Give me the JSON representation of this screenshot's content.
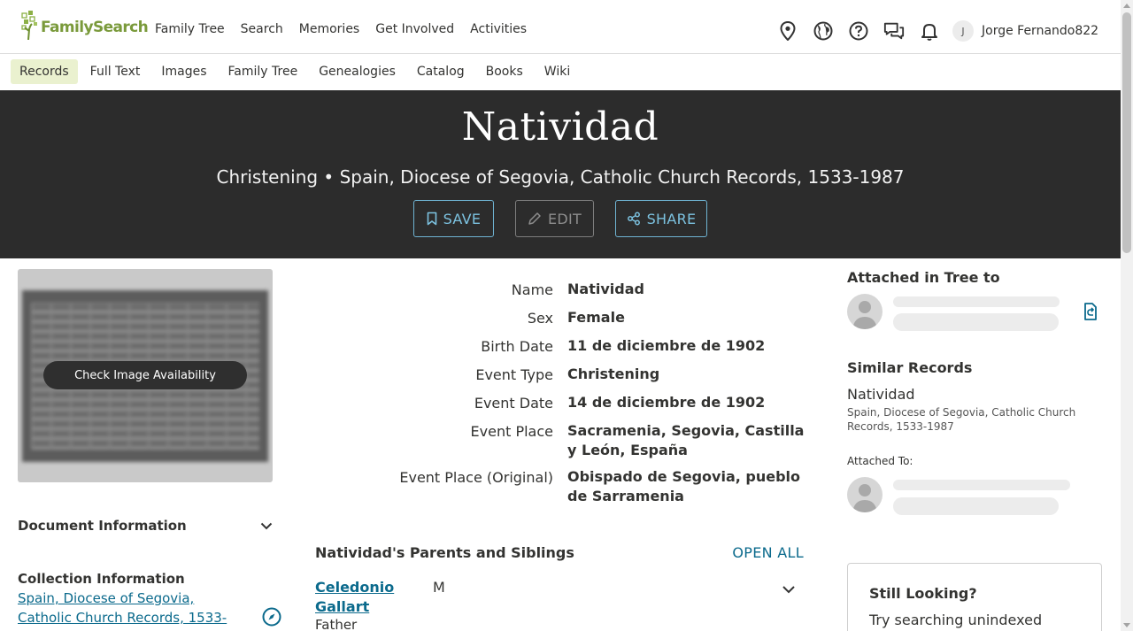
{
  "brand": {
    "name": "FamilySearch",
    "color": "#7a9a3b"
  },
  "main_nav": [
    "Family Tree",
    "Search",
    "Memories",
    "Get Involved",
    "Activities"
  ],
  "top_icons": [
    "location-pin-icon",
    "globe-icon",
    "help-icon",
    "chat-icon",
    "bell-icon"
  ],
  "user": {
    "initial": "J",
    "name": "Jorge Fernando822"
  },
  "sub_nav": {
    "items": [
      "Records",
      "Full Text",
      "Images",
      "Family Tree",
      "Genealogies",
      "Catalog",
      "Books",
      "Wiki"
    ],
    "active": "Records"
  },
  "hero": {
    "title": "Natividad",
    "subtitle": "Christening • Spain, Diocese of Segovia, Catholic Church Records, 1533-1987",
    "buttons": {
      "save": "SAVE",
      "edit": "EDIT",
      "share": "SHARE"
    }
  },
  "image_panel": {
    "check_label": "Check Image Availability"
  },
  "document_info": {
    "label": "Document Information"
  },
  "collection": {
    "title": "Collection Information",
    "link": "Spain, Diocese of Segovia, Catholic Church Records, 1533-"
  },
  "facts": [
    {
      "label": "Name",
      "value": "Natividad"
    },
    {
      "label": "Sex",
      "value": "Female"
    },
    {
      "label": "Birth Date",
      "value": "11 de diciembre de 1902"
    },
    {
      "label": "Event Type",
      "value": "Christening"
    },
    {
      "label": "Event Date",
      "value": "14 de diciembre de 1902"
    },
    {
      "label": "Event Place",
      "value": "Sacramenia, Segovia, Castilla y León, España"
    },
    {
      "label": "Event Place (Original)",
      "value": "Obispado de Segovia, pueblo de Sarramenia"
    }
  ],
  "parents": {
    "heading": "Natividad's Parents and Siblings",
    "open_all": "OPEN ALL",
    "person": {
      "name": "Celedonio Gallart",
      "sex": "M",
      "role": "Father"
    }
  },
  "right": {
    "attached_title": "Attached in Tree to",
    "similar_title": "Similar Records",
    "similar_name": "Natividad",
    "similar_collection": "Spain, Diocese of Segovia, Catholic Church Records, 1533-1987",
    "attached_to": "Attached To:",
    "still_title": "Still Looking?",
    "still_text": "Try searching unindexed"
  },
  "colors": {
    "hero_bg": "#2c2c2c",
    "link": "#0b6a8c",
    "hero_button": "#7cc2e0",
    "active_tab": "#eaf1cf"
  }
}
